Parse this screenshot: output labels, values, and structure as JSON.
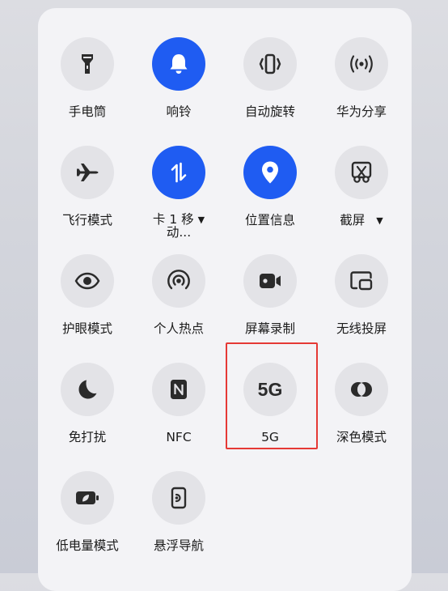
{
  "tiles": {
    "flashlight": {
      "label": "手电筒"
    },
    "ringer": {
      "label": "响铃"
    },
    "auto_rotate": {
      "label": "自动旋转"
    },
    "huawei_share": {
      "label": "华为分享"
    },
    "airplane": {
      "label": "飞行模式"
    },
    "mobile_data": {
      "label_line1": "卡 1 移",
      "label_line2": "动..."
    },
    "location": {
      "label": "位置信息"
    },
    "screenshot": {
      "label": "截屏"
    },
    "eye_comfort": {
      "label": "护眼模式"
    },
    "hotspot": {
      "label": "个人热点"
    },
    "screen_record": {
      "label": "屏幕录制"
    },
    "wireless_projection": {
      "label": "无线投屏"
    },
    "do_not_disturb": {
      "label": "免打扰"
    },
    "nfc": {
      "label": "NFC"
    },
    "five_g": {
      "label": "5G",
      "icon_text": "5G"
    },
    "dark_mode": {
      "label": "深色模式"
    },
    "power_saving": {
      "label": "低电量模式"
    },
    "floating_nav": {
      "label": "悬浮导航"
    }
  },
  "colors": {
    "active": "#1f5cf2",
    "inactive": "#e3e3e7",
    "highlight": "#e53935"
  }
}
